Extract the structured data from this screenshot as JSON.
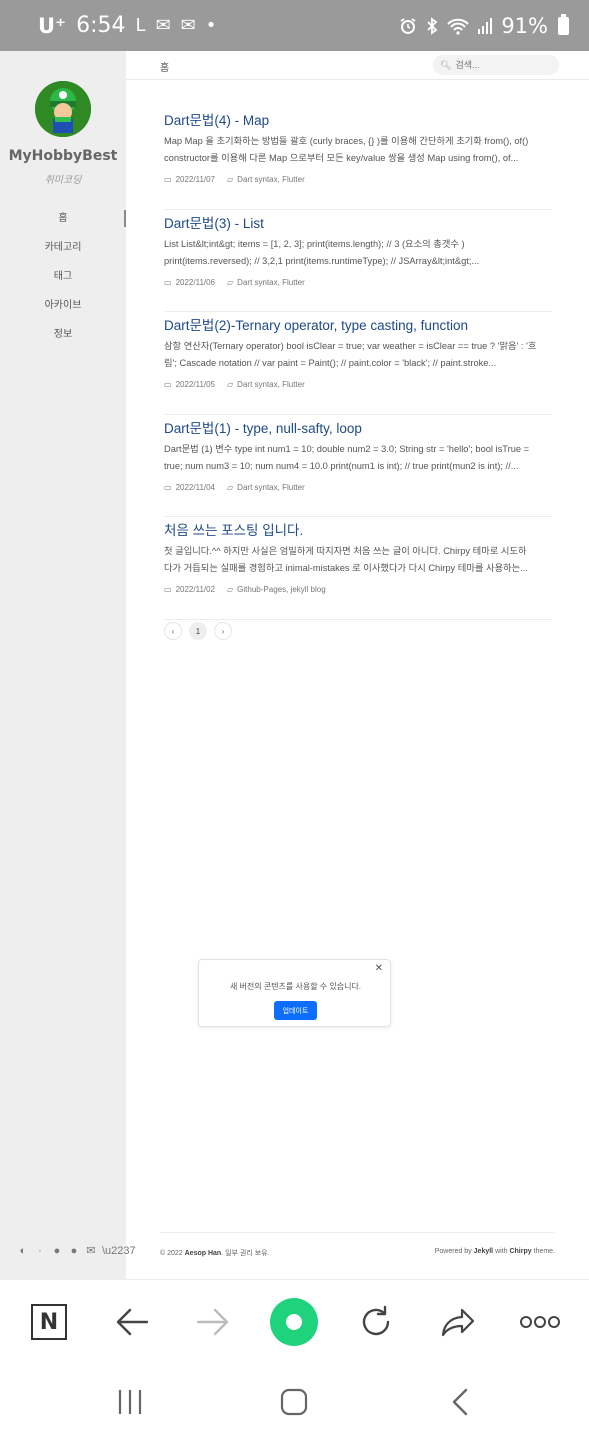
{
  "status_bar": {
    "carrier": "U⁺",
    "time": "6:54",
    "left_icons": [
      "L",
      "✉",
      "✉",
      "•"
    ],
    "battery": "91%",
    "right_icons": [
      "alarm-icon",
      "bluetooth-icon",
      "wifi-icon",
      "signal-icon",
      "battery-icon"
    ]
  },
  "sidebar": {
    "site_title": "MyHobbyBest",
    "site_subtitle": "취미코딩",
    "nav": [
      {
        "label": "홈",
        "active": true
      },
      {
        "label": "카테고리"
      },
      {
        "label": "태그"
      },
      {
        "label": "아카이브"
      },
      {
        "label": "정보"
      }
    ],
    "bottom_icons": [
      "theme-toggle-icon",
      "github-icon",
      "facebook-icon",
      "email-icon",
      "rss-icon"
    ]
  },
  "topbar": {
    "breadcrumb": "홈",
    "search_placeholder": "검색..."
  },
  "posts": [
    {
      "title": "Dart문법(4) - Map",
      "excerpt1": "Map Map 을 초기화하는 방법들 괄호 (curly braces, {} )를 이용해 간단하게 초기화 from(), of()",
      "excerpt2": "constructor를 이용해 다른 Map 으로부터 모든 key/value 쌍을 생성 Map using from(), of...",
      "date": "2022/11/07",
      "categories": "Dart syntax, Flutter"
    },
    {
      "title": "Dart문법(3) - List",
      "excerpt1": "List List&lt;int&gt; items = [1, 2, 3]; print(items.length); // 3 (요소의 총갯수 )",
      "excerpt2": "print(items.reversed); // 3,2,1 print(items.runtimeType); // JSArray&lt;int&gt;...",
      "date": "2022/11/06",
      "categories": "Dart syntax, Flutter"
    },
    {
      "title": "Dart문법(2)-Ternary operator, type casting, function",
      "excerpt1": "삼항 연산자(Ternary operator) bool isClear = true; var weather = isClear == true ? '맑음' : '흐",
      "excerpt2": "림'; Cascade notation // var paint = Paint(); // paint.color = 'black'; // paint.stroke...",
      "date": "2022/11/05",
      "categories": "Dart syntax, Flutter"
    },
    {
      "title": "Dart문법(1) - type, null-safty, loop",
      "excerpt1": "Dart문법 (1) 변수 type int num1 = 10; double num2 = 3.0; String str = 'hello'; bool isTrue =",
      "excerpt2": "true; num num3 = 10; num num4 = 10.0 print(num1 is int); // true print(mun2 is int); //...",
      "date": "2022/11/04",
      "categories": "Dart syntax, Flutter"
    },
    {
      "title": "처음 쓰는 포스팅 입니다.",
      "excerpt1": "첫 글입니다.^^ 하지만 사실은 엄밀하게 따지자면 처음 쓰는 글이 아니다. Chirpy 테마로 시도하",
      "excerpt2": "다가 거듭되는 실패를 경험하고 inimal-mistakes 로 이사했다가 다시 Chirpy 테마를 사용하는...",
      "date": "2022/11/02",
      "categories": "Github-Pages, jekyll blog"
    }
  ],
  "pagination": {
    "prev": "‹",
    "current": "1",
    "next": "›"
  },
  "toast": {
    "message": "새 버전의 콘텐츠를 사용할 수 있습니다.",
    "button": "업데이트",
    "close": "✕"
  },
  "footer": {
    "left_prefix": "© 2022 ",
    "left_author": "Aesop Han",
    "left_suffix": ". 일부 권리 보유.",
    "right_prefix": "Powered by ",
    "right_jekyll": "Jekyll",
    "right_mid": " with ",
    "right_chirpy": "Chirpy",
    "right_suffix": " theme."
  },
  "browser_bar": {
    "n_button": "N",
    "buttons": [
      "naver-home-icon",
      "back-icon",
      "forward-icon",
      "green-dot-icon",
      "refresh-icon",
      "share-icon",
      "more-icon"
    ]
  },
  "colors": {
    "status_bar": "#9a9a9a",
    "sidebar_bg": "#eeeeee",
    "link_blue": "#1e4a86",
    "update_button": "#0d6efd",
    "green_button": "#1fd27c"
  }
}
